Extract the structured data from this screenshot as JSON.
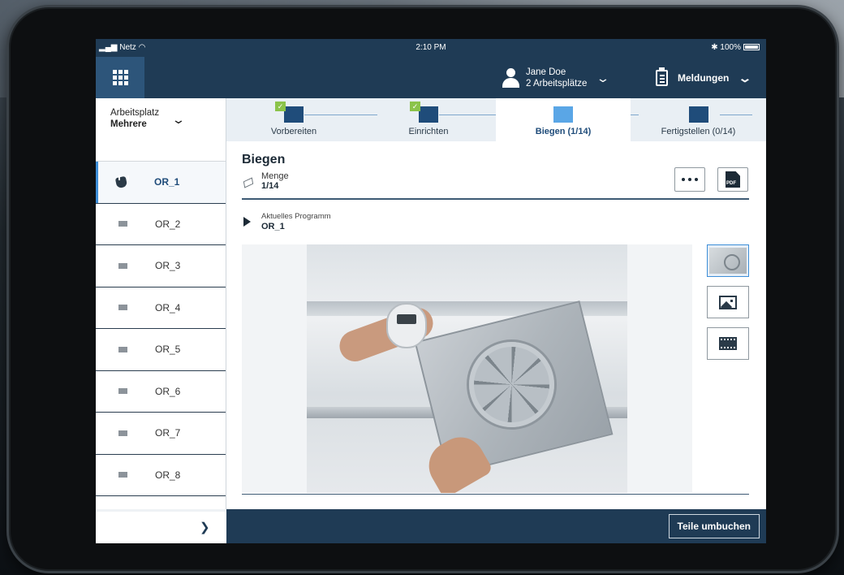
{
  "status_bar": {
    "carrier": "Netz",
    "time": "2:10 PM",
    "battery": "100%"
  },
  "header": {
    "user_name": "Jane Doe",
    "user_workplaces": "2 Arbeitsplätze",
    "messages_label": "Meldungen"
  },
  "sidebar": {
    "workplace_label": "Arbeitsplatz",
    "workplace_value": "Mehrere",
    "items": [
      {
        "label": "OR_1",
        "active": true
      },
      {
        "label": "OR_2"
      },
      {
        "label": "OR_3"
      },
      {
        "label": "OR_4"
      },
      {
        "label": "OR_5"
      },
      {
        "label": "OR_6"
      },
      {
        "label": "OR_7"
      },
      {
        "label": "OR_8"
      }
    ],
    "next_glyph": "❯"
  },
  "steps": [
    {
      "label": "Vorbereiten",
      "done": true
    },
    {
      "label": "Einrichten",
      "done": true
    },
    {
      "label": "Biegen (1/14)",
      "active": true
    },
    {
      "label": "Fertigstellen (0/14)"
    }
  ],
  "main": {
    "title": "Biegen",
    "quantity_label": "Menge",
    "quantity_value": "1/14",
    "program_label": "Aktuelles Programm",
    "program_value": "OR_1",
    "pdf_label": "PDF"
  },
  "footer": {
    "rebook_button": "Teile umbuchen"
  },
  "colors": {
    "nav": "#1f3b55",
    "accent": "#3d8ed8",
    "done_check": "#8bc34a"
  }
}
